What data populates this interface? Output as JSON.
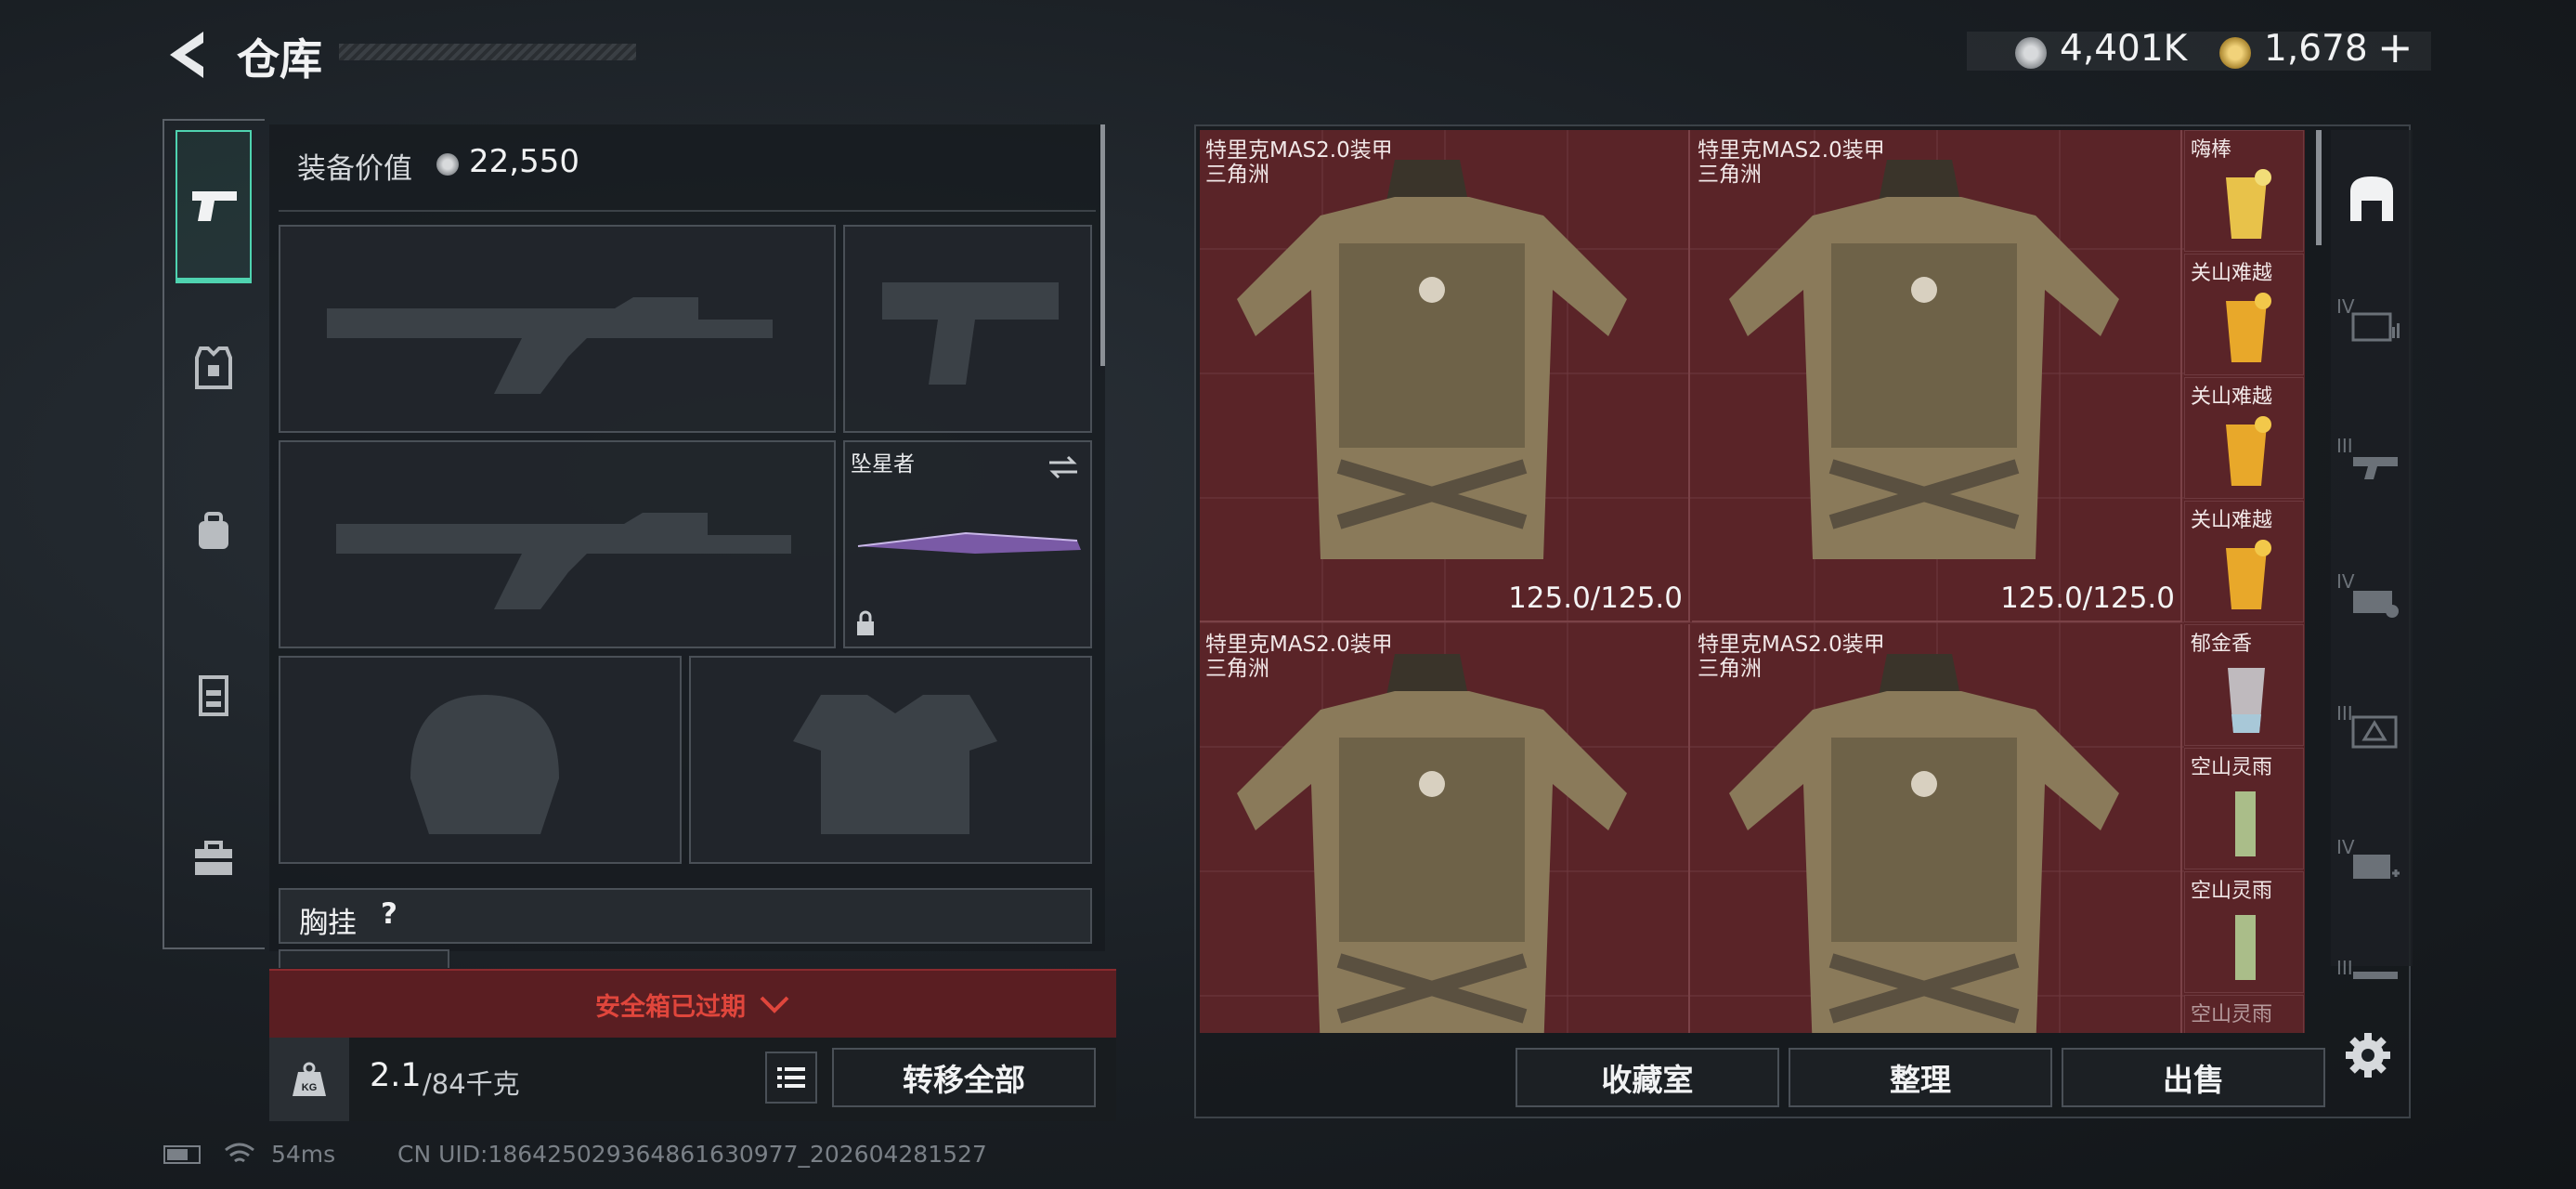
{
  "header": {
    "title": "仓库",
    "currency1": "4,401K",
    "currency2": "1,678",
    "plus": "+"
  },
  "loadout": {
    "value_label": "装备价值",
    "value": "22,550",
    "melee_name": "坠星者",
    "chest_rig_label": "胸挂",
    "help": "?",
    "safe_box_expired": "安全箱已过期",
    "weight_current": "2.1",
    "weight_max": "/84千克",
    "kg": "KG",
    "transfer_all": "转移全部"
  },
  "stash": {
    "armor": [
      {
        "name": "特里克MAS2.0装甲",
        "sub": "三角洲",
        "durability": "125.0/125.0"
      },
      {
        "name": "特里克MAS2.0装甲",
        "sub": "三角洲",
        "durability": "125.0/125.0"
      },
      {
        "name": "特里克MAS2.0装甲",
        "sub": "三角洲",
        "durability": ""
      },
      {
        "name": "特里克MAS2.0装甲",
        "sub": "三角洲",
        "durability": ""
      }
    ],
    "drinks": [
      "嗨棒",
      "关山难越",
      "关山难越",
      "关山难越",
      "郁金香",
      "空山灵雨",
      "空山灵雨",
      "空山灵雨"
    ],
    "buttons": {
      "collection": "收藏室",
      "sort": "整理",
      "sell": "出售"
    },
    "category_tabs": [
      "IV",
      "III",
      "IV",
      "III",
      "IV",
      "III"
    ]
  },
  "status": {
    "ping": "54ms",
    "uid": "CN UID:18642502936486163097​7_202604281527"
  },
  "colors": {
    "accent": "#4fd3b0",
    "danger": "#e0463c",
    "danger_bg": "#5a1e22",
    "slot_red": "#5a2428"
  }
}
